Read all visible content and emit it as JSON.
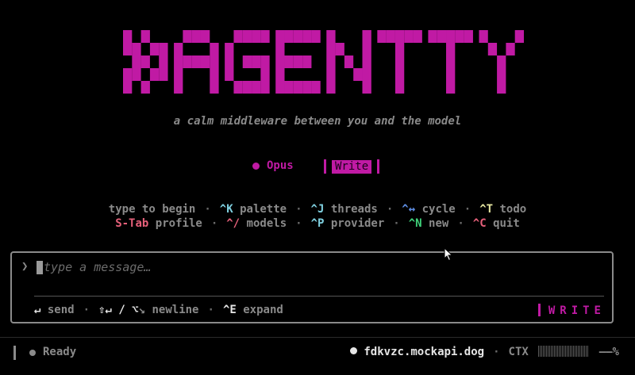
{
  "colors": {
    "accent": "#c01aa4",
    "muted": "#8a8a8a",
    "bright": "#e6e6e6",
    "key_cyan": "#7fd0e0",
    "key_blue": "#5f8fe6",
    "key_yellow": "#e6e6a0",
    "key_pink": "#e6607a",
    "key_green": "#3fd27a"
  },
  "header": {
    "logo_text": "»AGENTTY",
    "tagline": "a calm middleware between you and the model"
  },
  "mode": {
    "model": "Opus",
    "mode_label": "Write"
  },
  "hints": {
    "line1": [
      {
        "key": "",
        "label": "type to begin"
      },
      {
        "key": "^K",
        "label": "palette"
      },
      {
        "key": "^J",
        "label": "threads"
      },
      {
        "key": "^↔",
        "label": "cycle"
      },
      {
        "key": "^T",
        "label": "todo"
      }
    ],
    "line2": [
      {
        "key": "S-Tab",
        "label": "profile"
      },
      {
        "key": "^/",
        "label": "models"
      },
      {
        "key": "^P",
        "label": "provider"
      },
      {
        "key": "^N",
        "label": "new"
      },
      {
        "key": "^C",
        "label": "quit"
      }
    ]
  },
  "input": {
    "prompt_symbol": "❯",
    "placeholder": "type a message…",
    "value": ""
  },
  "input_footer": {
    "send_key": "↵",
    "send_label": "send",
    "newline_keys": "⇧↵ / ⌥",
    "newline_label": "newline",
    "expand_key": "^E",
    "expand_label": "expand",
    "mode_tag": "WRITE"
  },
  "status": {
    "state": "Ready",
    "host": "fdkvzc.mockapi.dog",
    "ctx_label": "CTX",
    "ctx_value": "——%"
  },
  "icons": {
    "status_dot": "circle-icon",
    "cursor": "mouse-pointer-icon"
  }
}
